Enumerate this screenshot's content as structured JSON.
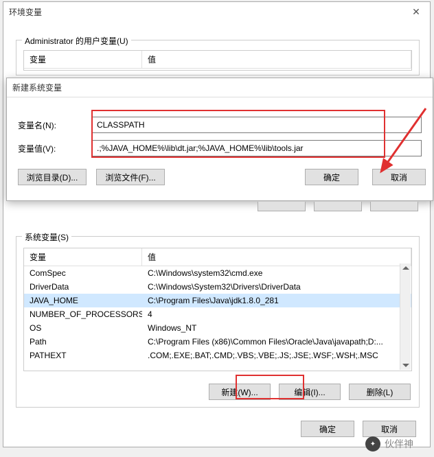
{
  "env_window": {
    "title": "环境变量",
    "user_group_label": "Administrator 的用户变量(U)",
    "user_table": {
      "col_var": "变量",
      "col_val": "值"
    },
    "sys_group_label": "系统变量(S)",
    "sys_table": {
      "col_var": "变量",
      "col_val": "值",
      "rows": [
        {
          "var": "ComSpec",
          "val": "C:\\Windows\\system32\\cmd.exe"
        },
        {
          "var": "DriverData",
          "val": "C:\\Windows\\System32\\Drivers\\DriverData"
        },
        {
          "var": "JAVA_HOME",
          "val": "C:\\Program Files\\Java\\jdk1.8.0_281",
          "selected": true
        },
        {
          "var": "NUMBER_OF_PROCESSORS",
          "val": "4"
        },
        {
          "var": "OS",
          "val": "Windows_NT"
        },
        {
          "var": "Path",
          "val": "C:\\Program Files (x86)\\Common Files\\Oracle\\Java\\javapath;D:..."
        },
        {
          "var": "PATHEXT",
          "val": ".COM;.EXE;.BAT;.CMD;.VBS;.VBE;.JS;.JSE;.WSF;.WSH;.MSC"
        }
      ]
    },
    "btn_new": "新建(W)...",
    "btn_edit": "编辑(I)...",
    "btn_delete": "删除(L)",
    "btn_ok": "确定",
    "btn_cancel": "取消"
  },
  "new_window": {
    "title": "新建系统变量",
    "name_label": "变量名(N):",
    "name_value": "CLASSPATH",
    "value_label": "变量值(V):",
    "value_value": ".;%JAVA_HOME%\\lib\\dt.jar;%JAVA_HOME%\\lib\\tools.jar",
    "btn_browse_dir": "浏览目录(D)...",
    "btn_browse_file": "浏览文件(F)...",
    "btn_ok": "确定",
    "btn_cancel": "取消"
  },
  "watermark": "伙伴神"
}
